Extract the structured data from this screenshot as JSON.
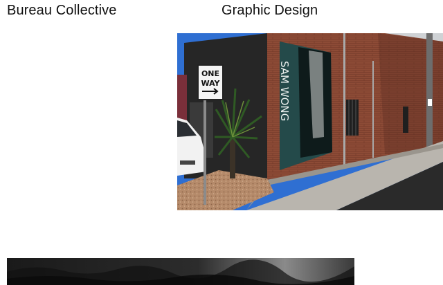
{
  "header": {
    "site_title": "Bureau Collective",
    "category": "Graphic Design"
  },
  "project": {
    "poster_text": "SAM WONG",
    "sign_line1": "ONE",
    "sign_line2": "WAY"
  },
  "colors": {
    "text": "#111111",
    "background": "#ffffff",
    "brick": "#8a4a36",
    "sky": "#2e6fd1"
  }
}
